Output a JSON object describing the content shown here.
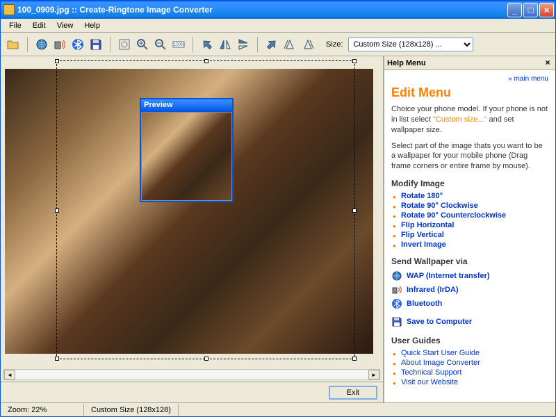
{
  "window": {
    "title": "100_0909.jpg :: Create-Ringtone Image Converter"
  },
  "menubar": {
    "file": "File",
    "edit": "Edit",
    "view": "View",
    "help": "Help"
  },
  "toolbar": {
    "size_label": "Size:",
    "size_value": "Custom Size (128x128) ..."
  },
  "preview": {
    "title": "Preview"
  },
  "bottom": {
    "exit": "Exit"
  },
  "status": {
    "zoom": "Zoom: 22%",
    "size": "Custom Size (128x128)"
  },
  "help": {
    "title": "Help Menu",
    "main_menu": "« main menu",
    "h1": "Edit Menu",
    "p1a": "Choice your phone model. If your phone is not in list select ",
    "p1b": "\"Custom size...\"",
    "p1c": " and set wallpaper size.",
    "p2": "Select part of the image thats you want to be a wallpaper for your mobile phone (Drag frame corners or entire frame by mouse).",
    "modify_h": "Modify Image",
    "modify": [
      "Rotate 180°",
      "Rotate 90° Clockwise",
      "Rotate 90° Counterclockwise",
      "Flip Horizontal",
      "Flip Vertical",
      "Invert Image"
    ],
    "send_h": "Send Wallpaper via",
    "send": {
      "wap": "WAP (Internet transfer)",
      "irda": "Infrared (IrDA)",
      "bt": "Bluetooth",
      "save": "Save to Computer"
    },
    "guides_h": "User Guides",
    "guides": [
      "Quick Start User Guide",
      "About Image Converter",
      "Technical Support",
      "Visit our Website"
    ]
  }
}
